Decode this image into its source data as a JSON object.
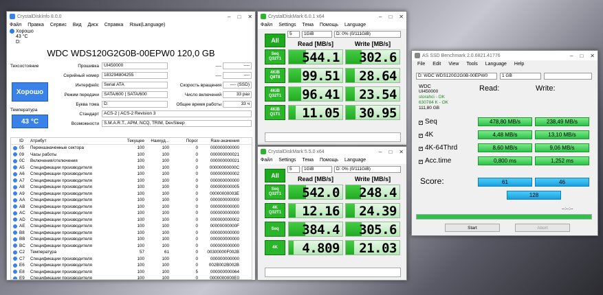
{
  "cdi": {
    "title": "CrystalDiskInfo 8.0.0",
    "menu": [
      "Файл",
      "Правка",
      "Сервис",
      "Вид",
      "Диск",
      "Справка",
      "Язык(Language)"
    ],
    "status_top": "Хорошо",
    "status_temp": "43 °C",
    "status_drive": "D:",
    "drive_title": "WDC WDS120G2G0B-00EPW0 120,0 GB",
    "health_label": "Техсостояние",
    "health_value": "Хорошо",
    "temp_label": "Температура",
    "temp_value": "43 °C",
    "firmware_label": "Прошивка",
    "firmware": "UI450000",
    "serial_label": "Серийный номер",
    "serial": "183294804255",
    "interface_label": "Интерфейс",
    "interface": "Serial ATA",
    "transfer_label": "Режим передачи",
    "transfer": "SATA/600 | SATA/600",
    "letter_label": "Буква тома",
    "letter": "D:",
    "standard_label": "Стандарт",
    "standard": "ACS-2 | ACS-2 Revision 3",
    "features_label": "Возможности",
    "features": "S.M.A.R.T., APM, NCQ, TRIM, DevSleep",
    "r1_dash": "----",
    "r1_val": "----",
    "r2_dash": "----",
    "r2_val": "----",
    "rot_label": "Скорость вращения",
    "rot": "---- (SSD)",
    "power_count_label": "Число включений",
    "power_count": "33 раз",
    "power_hours_label": "Общее время работы",
    "power_hours": "33 ч",
    "smart_headers": [
      "ID",
      "Атрибут",
      "Текущее",
      "Наихуд...",
      "Порог",
      "Raw-значения"
    ],
    "smart_rows": [
      [
        "05",
        "Переназначенные сектора",
        "100",
        "100",
        "0",
        "000000000000"
      ],
      [
        "09",
        "Часы работы",
        "100",
        "100",
        "0",
        "000000000021"
      ],
      [
        "0C",
        "Включения/отключения",
        "100",
        "100",
        "0",
        "000000000021"
      ],
      [
        "A5",
        "Спецификации производителя",
        "100",
        "100",
        "0",
        "00000000000C"
      ],
      [
        "A6",
        "Спецификации производителя",
        "100",
        "100",
        "0",
        "000000000002"
      ],
      [
        "A7",
        "Спецификации производителя",
        "100",
        "100",
        "0",
        "000000000000"
      ],
      [
        "A8",
        "Спецификации производителя",
        "100",
        "100",
        "0",
        "000000000005"
      ],
      [
        "A9",
        "Спецификации производителя",
        "100",
        "100",
        "0",
        "00000000003E"
      ],
      [
        "AA",
        "Спецификации производителя",
        "100",
        "100",
        "0",
        "000000000000"
      ],
      [
        "AB",
        "Спецификации производителя",
        "100",
        "100",
        "0",
        "000000000000"
      ],
      [
        "AC",
        "Спецификации производителя",
        "100",
        "100",
        "0",
        "000000000000"
      ],
      [
        "AD",
        "Спецификации производителя",
        "100",
        "100",
        "0",
        "000000000002"
      ],
      [
        "AE",
        "Спецификации производителя",
        "100",
        "100",
        "0",
        "00000000000F"
      ],
      [
        "B8",
        "Спецификации производителя",
        "100",
        "100",
        "0",
        "000000000000"
      ],
      [
        "BB",
        "Спецификации производителя",
        "100",
        "100",
        "0",
        "000000000000"
      ],
      [
        "BC",
        "Спецификации производителя",
        "100",
        "100",
        "0",
        "000000000000"
      ],
      [
        "C2",
        "Температура",
        "57",
        "61",
        "0",
        "00300000F002B"
      ],
      [
        "C7",
        "Спецификации производителя",
        "100",
        "100",
        "0",
        "000000000000"
      ],
      [
        "E6",
        "Спецификации производителя",
        "100",
        "100",
        "0",
        "002B002B002B"
      ],
      [
        "E8",
        "Спецификации производителя",
        "100",
        "100",
        "5",
        "000000000064"
      ],
      [
        "E9",
        "Спецификации производителя",
        "100",
        "100",
        "0",
        "0000000000E0"
      ],
      [
        "EA",
        "Спецификации производителя",
        "100",
        "100",
        "0",
        "000000036036"
      ]
    ]
  },
  "cdm6": {
    "title": "CrystalDiskMark 6.0.1 x64",
    "menu": [
      "Файл",
      "Settings",
      "Тема",
      "Помощь",
      "Language"
    ],
    "count": "5",
    "size": "1GiB",
    "drive": "D: 0% (0/111GiB)",
    "all": "All",
    "read_head": "Read [MB/s]",
    "write_head": "Write [MB/s]",
    "tests": [
      {
        "name": "Seq\nQ32T1",
        "read": "544.1",
        "write": "302.6"
      },
      {
        "name": "4KiB\nQ8T8",
        "read": "99.51",
        "write": "28.64"
      },
      {
        "name": "4KiB\nQ32T1",
        "read": "96.41",
        "write": "23.54"
      },
      {
        "name": "4KiB\nQ1T1",
        "read": "11.05",
        "write": "30.95"
      }
    ]
  },
  "cdm5": {
    "title": "CrystalDiskMark 5.5.0 x64",
    "menu": [
      "Файл",
      "Settings",
      "Тема",
      "Помощь",
      "Language"
    ],
    "count": "5",
    "size": "1GiB",
    "drive": "D: 0% (0/111GiB)",
    "all": "All",
    "read_head": "Read [MB/s]",
    "write_head": "Write [MB/s]",
    "tests": [
      {
        "name": "Seq\nQ32T1",
        "read": "542.0",
        "write": "248.4"
      },
      {
        "name": "4K\nQ32T1",
        "read": "12.16",
        "write": "24.39"
      },
      {
        "name": "Seq",
        "read": "384.4",
        "write": "305.6"
      },
      {
        "name": "4K",
        "read": "4.809",
        "write": "21.03"
      }
    ]
  },
  "asssd": {
    "title": "AS SSD Benchmark 2.0.6821.41776",
    "menu": [
      "File",
      "Edit",
      "View",
      "Tools",
      "Language",
      "Help"
    ],
    "drive_sel": "D: WDC WDS120G2G0B-00EPW0",
    "size_sel": "1 GB",
    "info": [
      "WDC",
      "UI450000",
      "storahci - OK",
      "630784 K - OK",
      "111,80 GB"
    ],
    "read_head": "Read:",
    "write_head": "Write:",
    "rows": [
      {
        "label": "Seq",
        "read": "478,80 MB/s",
        "write": "238,49 MB/s"
      },
      {
        "label": "4K",
        "read": "4,48 MB/s",
        "write": "13,10 MB/s"
      },
      {
        "label": "4K-64Thrd",
        "read": "8,60 MB/s",
        "write": "9,06 MB/s"
      },
      {
        "label": "Acc.time",
        "read": "0,800 ms",
        "write": "1,252 ms"
      }
    ],
    "score_label": "Score:",
    "score_read": "61",
    "score_write": "46",
    "score_total": "128",
    "progress_text": "--:--:--",
    "start": "Start",
    "abort": "Abort"
  }
}
